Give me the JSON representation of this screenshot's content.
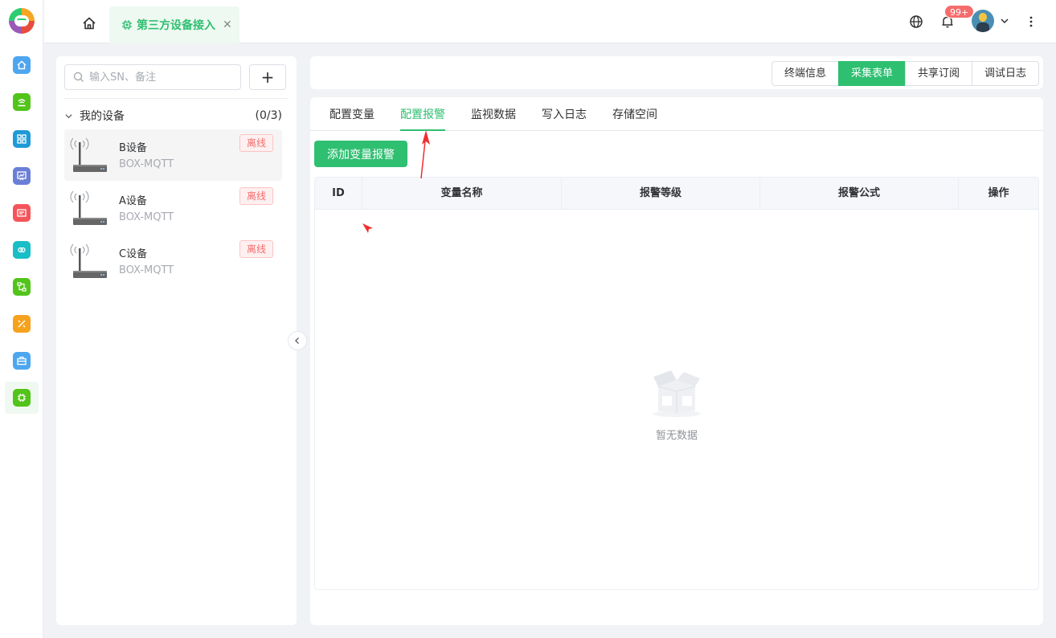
{
  "rail": {
    "items": [
      {
        "name": "home",
        "color": "#4da6f0"
      },
      {
        "name": "network",
        "color": "#52c41a"
      },
      {
        "name": "apps",
        "color": "#1f9ad6"
      },
      {
        "name": "chart",
        "color": "#6b7fd7"
      },
      {
        "name": "device",
        "color": "#f5555a"
      },
      {
        "name": "link",
        "color": "#19bec6"
      },
      {
        "name": "flow",
        "color": "#52c41a"
      },
      {
        "name": "tools",
        "color": "#f6a21e"
      },
      {
        "name": "briefcase",
        "color": "#4da6f0"
      },
      {
        "name": "chip",
        "color": "#52c41a"
      }
    ]
  },
  "topbar": {
    "tab_label": "第三方设备接入",
    "badge": "99+"
  },
  "left": {
    "search_placeholder": "输入SN、备注",
    "add_label": "+",
    "group_title": "我的设备",
    "group_count": "(0/3)",
    "devices": [
      {
        "name": "B设备",
        "model": "BOX-MQTT",
        "status": "离线"
      },
      {
        "name": "A设备",
        "model": "BOX-MQTT",
        "status": "离线"
      },
      {
        "name": "C设备",
        "model": "BOX-MQTT",
        "status": "离线"
      }
    ]
  },
  "segments": [
    "终端信息",
    "采集表单",
    "共享订阅",
    "调试日志"
  ],
  "tabs": [
    "配置变量",
    "配置报警",
    "监视数据",
    "写入日志",
    "存储空间"
  ],
  "add_alarm_label": "添加变量报警",
  "table": {
    "columns": [
      "ID",
      "变量名称",
      "报警等级",
      "报警公式",
      "操作"
    ],
    "empty_text": "暂无数据"
  },
  "colors": {
    "accent": "#2fbf71",
    "danger": "#f56c6c"
  }
}
